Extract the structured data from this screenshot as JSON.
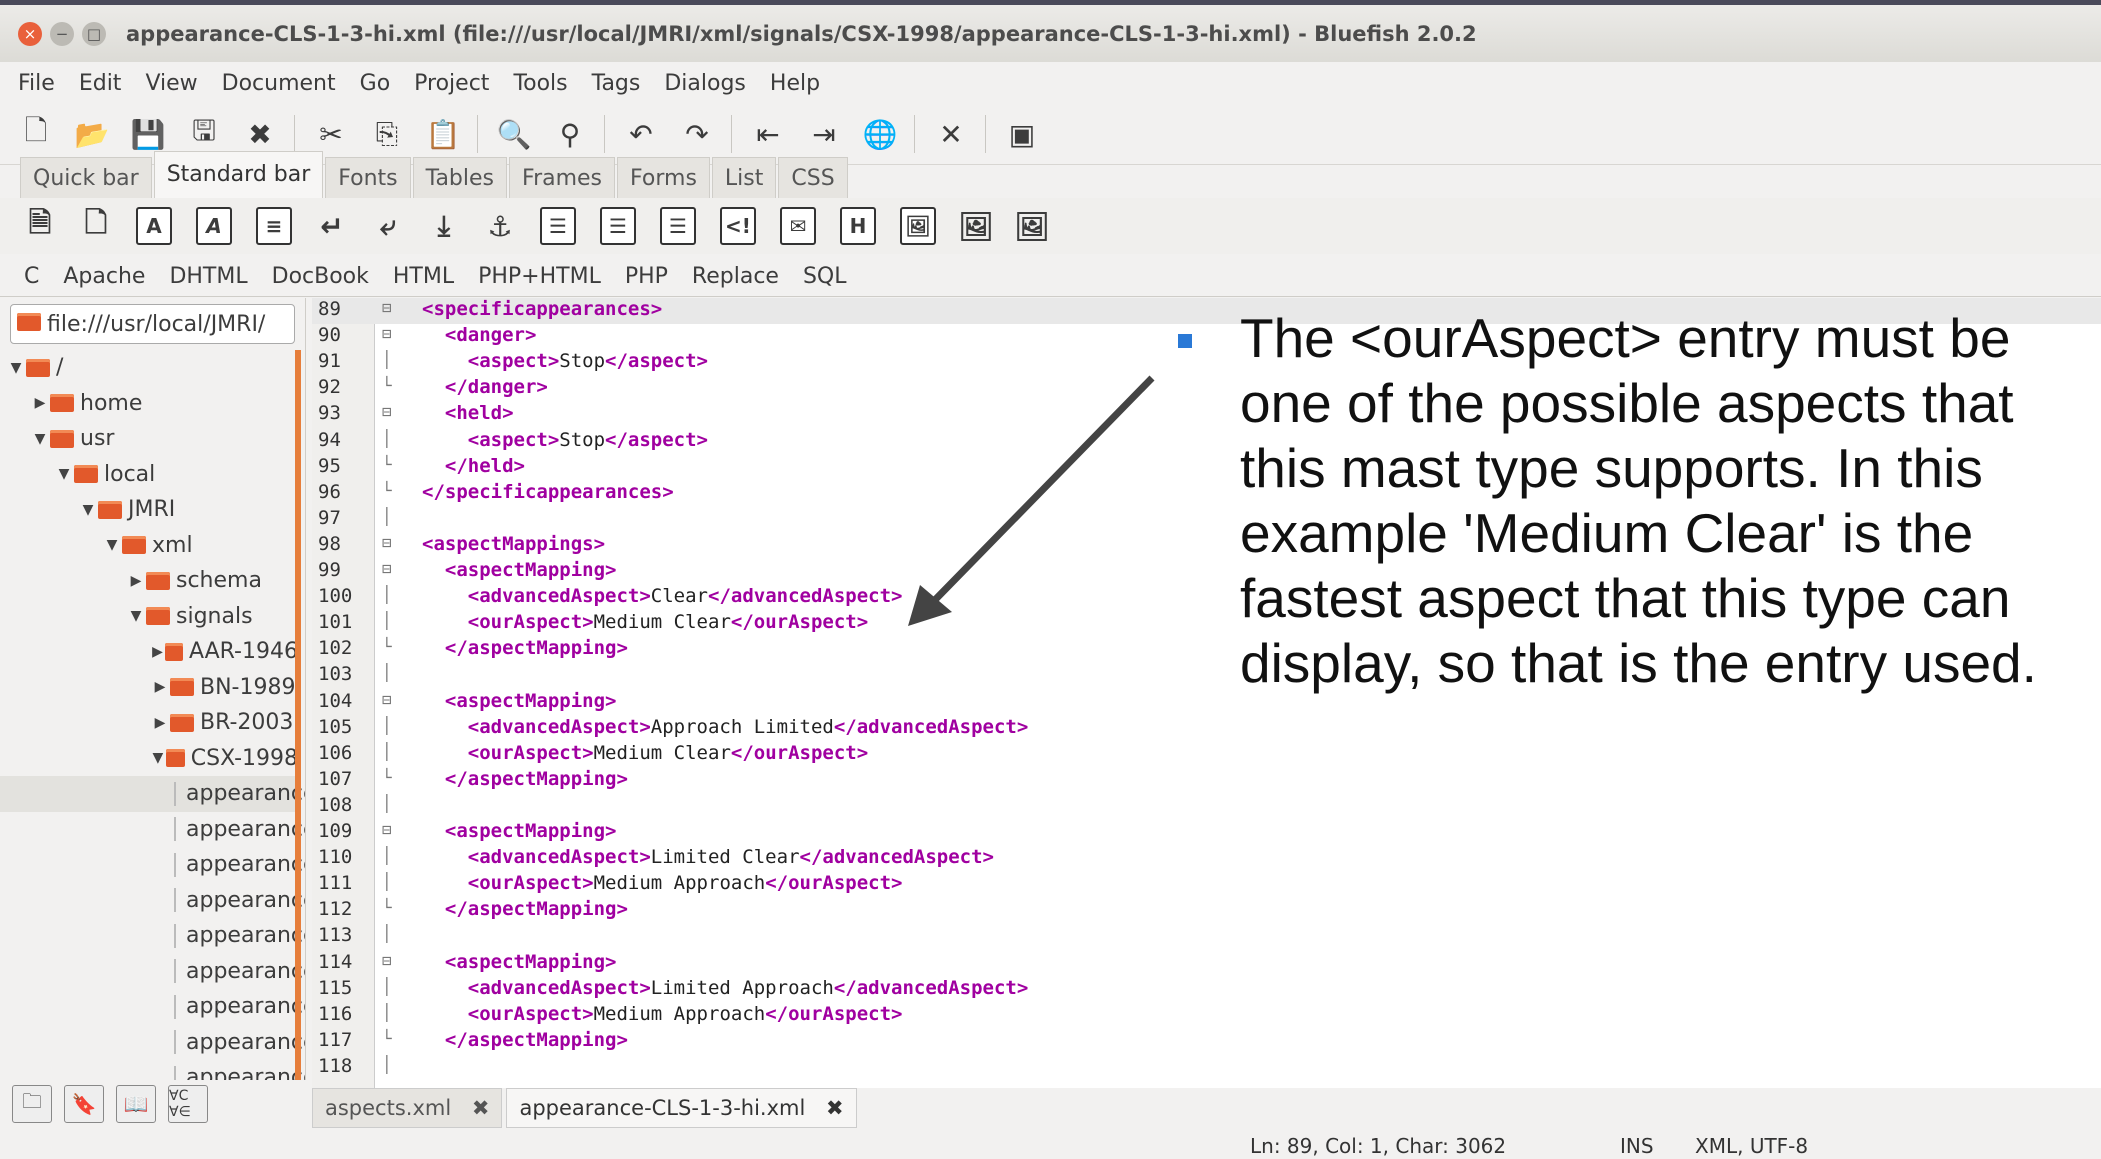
{
  "window": {
    "title": "appearance-CLS-1-3-hi.xml (file:///usr/local/JMRI/xml/signals/CSX-1998/appearance-CLS-1-3-hi.xml) - Bluefish 2.0.2"
  },
  "menubar": [
    "File",
    "Edit",
    "View",
    "Document",
    "Go",
    "Project",
    "Tools",
    "Tags",
    "Dialogs",
    "Help"
  ],
  "toolbar_icons": [
    "new-icon",
    "open-icon",
    "save-icon",
    "save-as-icon",
    "close-icon",
    "cut-icon",
    "copy-icon",
    "paste-icon",
    "find-icon",
    "replace-icon",
    "undo-icon",
    "redo-icon",
    "unindent-icon",
    "indent-icon",
    "preview-icon",
    "preferences-icon",
    "fullscreen-icon"
  ],
  "tabs": [
    "Quick bar",
    "Standard bar",
    "Fonts",
    "Tables",
    "Frames",
    "Forms",
    "List",
    "CSS"
  ],
  "tabs_active": "Standard bar",
  "toolbar2": {
    "heading_button": "H"
  },
  "filters": [
    "C",
    "Apache",
    "DHTML",
    "DocBook",
    "HTML",
    "PHP+HTML",
    "PHP",
    "Replace",
    "SQL"
  ],
  "sidebar": {
    "path": "file:///usr/local/JMRI/",
    "tree": [
      {
        "label": "/",
        "depth": 0,
        "type": "folder",
        "tri": "▼"
      },
      {
        "label": "home",
        "depth": 1,
        "type": "folder",
        "tri": "▶"
      },
      {
        "label": "usr",
        "depth": 1,
        "type": "folder",
        "tri": "▼"
      },
      {
        "label": "local",
        "depth": 2,
        "type": "folder",
        "tri": "▼"
      },
      {
        "label": "JMRI",
        "depth": 3,
        "type": "folder",
        "tri": "▼"
      },
      {
        "label": "xml",
        "depth": 4,
        "type": "folder",
        "tri": "▼"
      },
      {
        "label": "schema",
        "depth": 5,
        "type": "folder",
        "tri": "▶"
      },
      {
        "label": "signals",
        "depth": 5,
        "type": "folder",
        "tri": "▼"
      },
      {
        "label": "AAR-1946",
        "depth": 6,
        "type": "folder",
        "tri": "▶"
      },
      {
        "label": "BN-1989",
        "depth": 6,
        "type": "folder",
        "tri": "▶"
      },
      {
        "label": "BR-2003",
        "depth": 6,
        "type": "folder",
        "tri": "▶"
      },
      {
        "label": "CSX-1998",
        "depth": 6,
        "type": "folder",
        "tri": "▼"
      },
      {
        "label": "appearance",
        "depth": 7,
        "type": "file",
        "tri": "",
        "selected": true
      },
      {
        "label": "appearance",
        "depth": 7,
        "type": "file",
        "tri": ""
      },
      {
        "label": "appearance",
        "depth": 7,
        "type": "file",
        "tri": ""
      },
      {
        "label": "appearance",
        "depth": 7,
        "type": "file",
        "tri": ""
      },
      {
        "label": "appearance",
        "depth": 7,
        "type": "file",
        "tri": ""
      },
      {
        "label": "appearance",
        "depth": 7,
        "type": "file",
        "tri": ""
      },
      {
        "label": "appearance",
        "depth": 7,
        "type": "file",
        "tri": ""
      },
      {
        "label": "appearance",
        "depth": 7,
        "type": "file",
        "tri": ""
      },
      {
        "label": "appearance",
        "depth": 7,
        "type": "file",
        "tri": ""
      }
    ]
  },
  "editor": {
    "lines": [
      {
        "n": "89",
        "fold": "⊟",
        "code": [
          [
            "tag",
            "<specificappearances>"
          ]
        ]
      },
      {
        "n": "90",
        "fold": "⊟",
        "code": [
          [
            "txt",
            "  "
          ],
          [
            "tag",
            "<danger>"
          ]
        ]
      },
      {
        "n": "91",
        "fold": "│",
        "code": [
          [
            "txt",
            "    "
          ],
          [
            "tag",
            "<aspect>"
          ],
          [
            "txt",
            "Stop"
          ],
          [
            "tag",
            "</aspect>"
          ]
        ]
      },
      {
        "n": "92",
        "fold": "└",
        "code": [
          [
            "txt",
            "  "
          ],
          [
            "tag",
            "</danger>"
          ]
        ]
      },
      {
        "n": "93",
        "fold": "⊟",
        "code": [
          [
            "txt",
            "  "
          ],
          [
            "tag",
            "<held>"
          ]
        ]
      },
      {
        "n": "94",
        "fold": "│",
        "code": [
          [
            "txt",
            "    "
          ],
          [
            "tag",
            "<aspect>"
          ],
          [
            "txt",
            "Stop"
          ],
          [
            "tag",
            "</aspect>"
          ]
        ]
      },
      {
        "n": "95",
        "fold": "└",
        "code": [
          [
            "txt",
            "  "
          ],
          [
            "tag",
            "</held>"
          ]
        ]
      },
      {
        "n": "96",
        "fold": "└",
        "code": [
          [
            "tag",
            "</specificappearances>"
          ]
        ]
      },
      {
        "n": "97",
        "fold": "│",
        "code": []
      },
      {
        "n": "98",
        "fold": "⊟",
        "code": [
          [
            "tag",
            "<aspectMappings>"
          ]
        ]
      },
      {
        "n": "99",
        "fold": "⊟",
        "code": [
          [
            "txt",
            "  "
          ],
          [
            "tag",
            "<aspectMapping>"
          ]
        ]
      },
      {
        "n": "100",
        "fold": "│",
        "code": [
          [
            "txt",
            "    "
          ],
          [
            "tag",
            "<advancedAspect>"
          ],
          [
            "txt",
            "Clear"
          ],
          [
            "tag",
            "</advancedAspect>"
          ]
        ]
      },
      {
        "n": "101",
        "fold": "│",
        "code": [
          [
            "txt",
            "    "
          ],
          [
            "tag",
            "<ourAspect>"
          ],
          [
            "txt",
            "Medium Clear"
          ],
          [
            "tag",
            "</ourAspect>"
          ]
        ]
      },
      {
        "n": "102",
        "fold": "└",
        "code": [
          [
            "txt",
            "  "
          ],
          [
            "tag",
            "</aspectMapping>"
          ]
        ]
      },
      {
        "n": "103",
        "fold": "│",
        "code": []
      },
      {
        "n": "104",
        "fold": "⊟",
        "code": [
          [
            "txt",
            "  "
          ],
          [
            "tag",
            "<aspectMapping>"
          ]
        ]
      },
      {
        "n": "105",
        "fold": "│",
        "code": [
          [
            "txt",
            "    "
          ],
          [
            "tag",
            "<advancedAspect>"
          ],
          [
            "txt",
            "Approach Limited"
          ],
          [
            "tag",
            "</advancedAspect>"
          ]
        ]
      },
      {
        "n": "106",
        "fold": "│",
        "code": [
          [
            "txt",
            "    "
          ],
          [
            "tag",
            "<ourAspect>"
          ],
          [
            "txt",
            "Medium Clear"
          ],
          [
            "tag",
            "</ourAspect>"
          ]
        ]
      },
      {
        "n": "107",
        "fold": "└",
        "code": [
          [
            "txt",
            "  "
          ],
          [
            "tag",
            "</aspectMapping>"
          ]
        ]
      },
      {
        "n": "108",
        "fold": "│",
        "code": []
      },
      {
        "n": "109",
        "fold": "⊟",
        "code": [
          [
            "txt",
            "  "
          ],
          [
            "tag",
            "<aspectMapping>"
          ]
        ]
      },
      {
        "n": "110",
        "fold": "│",
        "code": [
          [
            "txt",
            "    "
          ],
          [
            "tag",
            "<advancedAspect>"
          ],
          [
            "txt",
            "Limited Clear"
          ],
          [
            "tag",
            "</advancedAspect>"
          ]
        ]
      },
      {
        "n": "111",
        "fold": "│",
        "code": [
          [
            "txt",
            "    "
          ],
          [
            "tag",
            "<ourAspect>"
          ],
          [
            "txt",
            "Medium Approach"
          ],
          [
            "tag",
            "</ourAspect>"
          ]
        ]
      },
      {
        "n": "112",
        "fold": "└",
        "code": [
          [
            "txt",
            "  "
          ],
          [
            "tag",
            "</aspectMapping>"
          ]
        ]
      },
      {
        "n": "113",
        "fold": "│",
        "code": []
      },
      {
        "n": "114",
        "fold": "⊟",
        "code": [
          [
            "txt",
            "  "
          ],
          [
            "tag",
            "<aspectMapping>"
          ]
        ]
      },
      {
        "n": "115",
        "fold": "│",
        "code": [
          [
            "txt",
            "    "
          ],
          [
            "tag",
            "<advancedAspect>"
          ],
          [
            "txt",
            "Limited Approach"
          ],
          [
            "tag",
            "</advancedAspect>"
          ]
        ]
      },
      {
        "n": "116",
        "fold": "│",
        "code": [
          [
            "txt",
            "    "
          ],
          [
            "tag",
            "<ourAspect>"
          ],
          [
            "txt",
            "Medium Approach"
          ],
          [
            "tag",
            "</ourAspect>"
          ]
        ]
      },
      {
        "n": "117",
        "fold": "└",
        "code": [
          [
            "txt",
            "  "
          ],
          [
            "tag",
            "</aspectMapping>"
          ]
        ]
      },
      {
        "n": "118",
        "fold": "│",
        "code": []
      }
    ]
  },
  "annotation": {
    "text": "The <ourAspect> entry must be one of the possible aspects that this mast type supports. In this example 'Medium Clear' is the fastest aspect that this type can display, so that is the entry used."
  },
  "bottom_icons": [
    "folder-icon",
    "bookmark-icon",
    "fref-icon",
    "charmap-icon"
  ],
  "bottom_charmap_label": "∀C ∀∈",
  "doc_tabs": [
    {
      "label": "aspects.xml",
      "active": false
    },
    {
      "label": "appearance-CLS-1-3-hi.xml",
      "active": true
    }
  ],
  "status": {
    "position": "Ln: 89, Col: 1, Char: 3062",
    "mode": "INS",
    "encoding": "XML, UTF-8"
  },
  "colors": {
    "tag": "#a000a0",
    "accent": "#e2592b",
    "bullet": "#2a79d6"
  }
}
